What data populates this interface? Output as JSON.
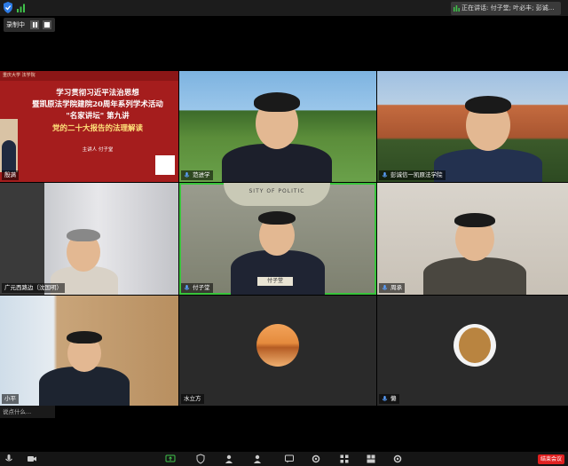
{
  "topbar": {
    "speaking_text": "正在讲话: 付子堂; 叶必丰; 彭诚..."
  },
  "recording": {
    "label": "录制中"
  },
  "slide": {
    "header": "重庆大学 法学院",
    "line1": "学习贯彻习近平法治思想",
    "line2": "暨凯原法学院建院20周年系列学术活动",
    "line3": "\"名家讲坛\" 第九讲",
    "line4": "党的二十大报告的法理解读",
    "speaker_line": "主讲人 付子堂",
    "tag": "殷满"
  },
  "tiles": [
    {
      "name": "范进学",
      "mic": true
    },
    {
      "name": "彭诚信一凯原法学院",
      "mic": true
    },
    {
      "name": "广元西路边（沈国明）",
      "mic": false
    },
    {
      "name": "付子堂",
      "mic": true
    },
    {
      "name": "周承",
      "mic": true
    },
    {
      "name": "小平",
      "mic": false
    },
    {
      "name": "水立方",
      "mic": false
    },
    {
      "name": "懒",
      "mic": true
    }
  ],
  "center": {
    "logo_text": "SITY OF POLITIC",
    "nameplate": "付子堂"
  },
  "chat_float": {
    "text": "说点什么..."
  },
  "toolbar": {
    "end_label": "结束会议"
  },
  "colors": {
    "active_border": "#38c43b",
    "slide_red": "#a51d1d",
    "end_red": "#e02020"
  }
}
